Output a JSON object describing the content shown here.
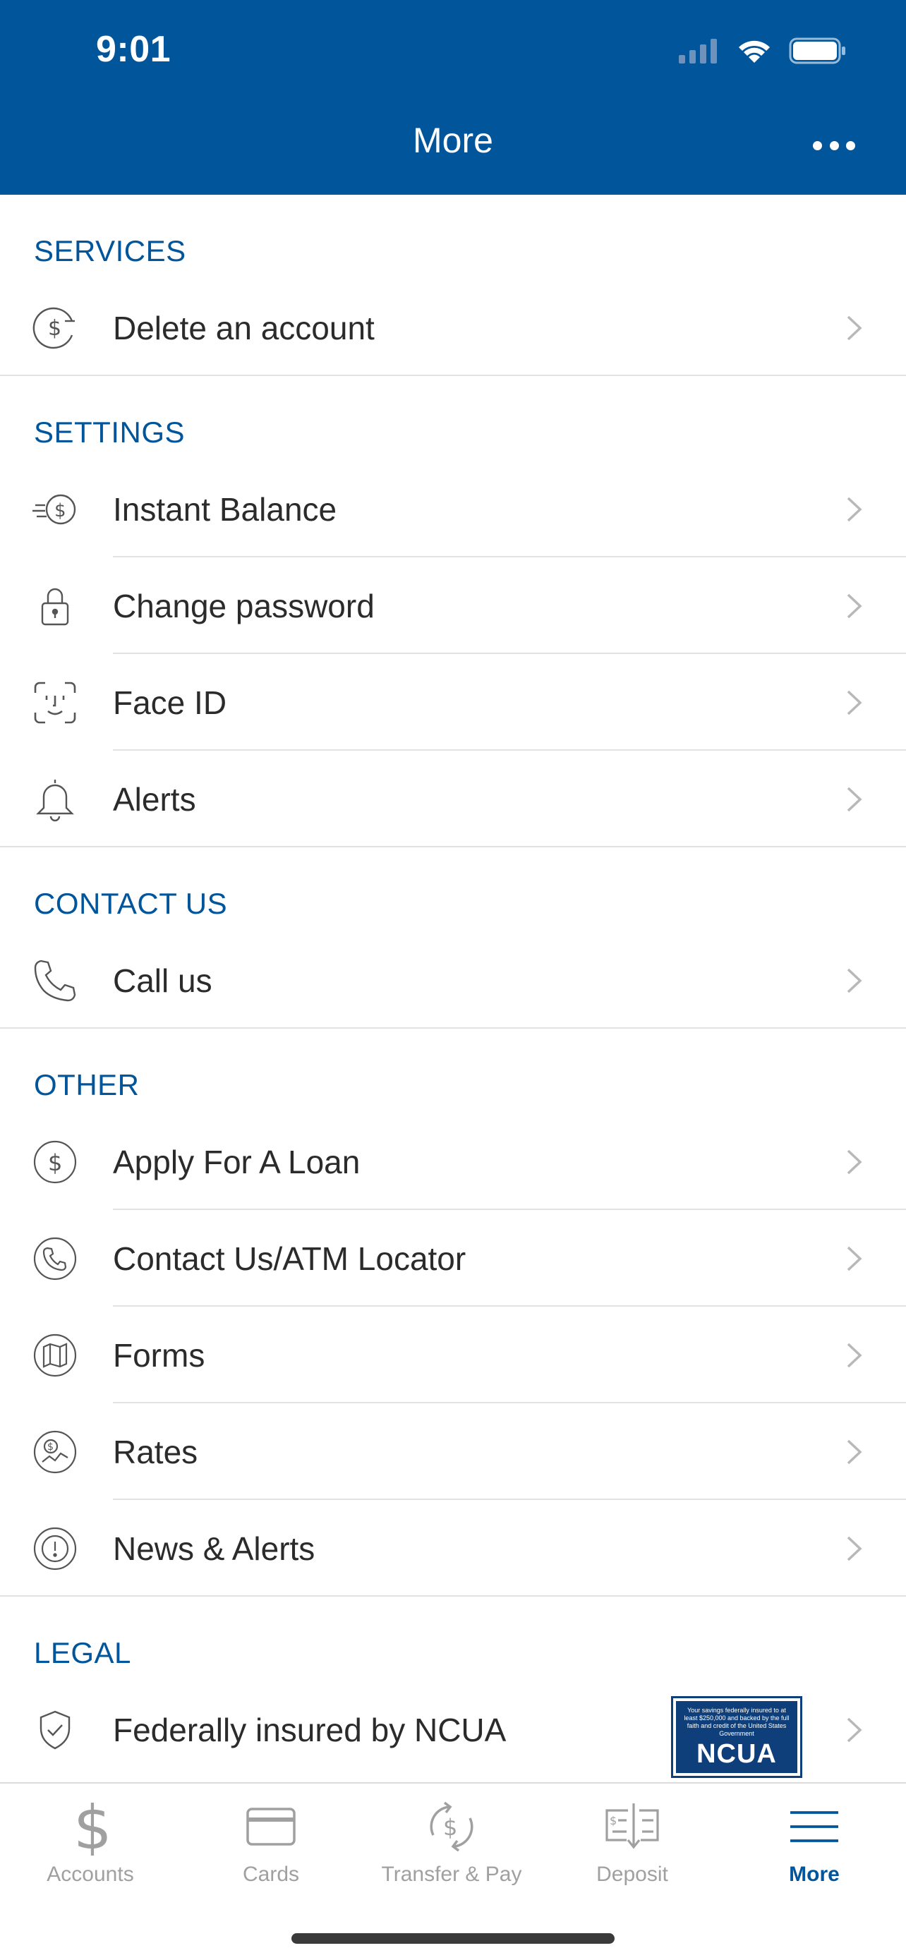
{
  "status_bar": {
    "time": "9:01"
  },
  "header": {
    "title": "More"
  },
  "sections": [
    {
      "title": "SERVICES",
      "items": [
        {
          "label": "Delete an account",
          "icon": "dollar-minus-icon"
        }
      ]
    },
    {
      "title": "SETTINGS",
      "items": [
        {
          "label": "Instant Balance",
          "icon": "fast-dollar-icon"
        },
        {
          "label": "Change password",
          "icon": "lock-icon"
        },
        {
          "label": "Face ID",
          "icon": "face-id-icon"
        },
        {
          "label": "Alerts",
          "icon": "bell-icon"
        }
      ]
    },
    {
      "title": "CONTACT US",
      "items": [
        {
          "label": "Call us",
          "icon": "phone-icon"
        }
      ]
    },
    {
      "title": "OTHER",
      "items": [
        {
          "label": "Apply For A Loan",
          "icon": "dollar-circle-icon"
        },
        {
          "label": "Contact Us/ATM Locator",
          "icon": "phone-circle-icon"
        },
        {
          "label": "Forms",
          "icon": "map-circle-icon"
        },
        {
          "label": "Rates",
          "icon": "rates-circle-icon"
        },
        {
          "label": "News & Alerts",
          "icon": "exclamation-circle-icon"
        }
      ]
    },
    {
      "title": "LEGAL",
      "items": [
        {
          "label": "Federally insured by NCUA",
          "icon": "shield-check-icon",
          "badge": "NCUA"
        }
      ]
    }
  ],
  "ncua_badge": {
    "small_text": "Your savings federally insured to at least $250,000 and backed by the full faith and credit of the United States Government",
    "big_text": "NCUA"
  },
  "tabbar": {
    "tabs": [
      {
        "label": "Accounts",
        "icon": "dollar-sign-icon",
        "active": false
      },
      {
        "label": "Cards",
        "icon": "card-icon",
        "active": false
      },
      {
        "label": "Transfer & Pay",
        "icon": "transfer-dollar-icon",
        "active": false
      },
      {
        "label": "Deposit",
        "icon": "check-deposit-icon",
        "active": false
      },
      {
        "label": "More",
        "icon": "menu-icon",
        "active": true
      }
    ]
  },
  "colors": {
    "brand": "#01559b",
    "section_title": "#01559b",
    "inactive_tab": "#a0a0a0"
  }
}
